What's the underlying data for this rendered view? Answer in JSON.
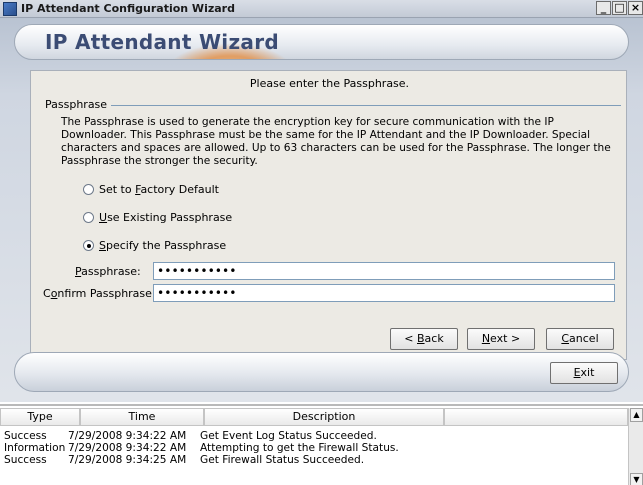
{
  "window": {
    "title": "IP Attendant Configuration Wizard",
    "minimize_label": "_",
    "maximize_label": "□",
    "close_label": "×"
  },
  "banner": {
    "title": "IP Attendant Wizard"
  },
  "prompt": "Please enter the Passphrase.",
  "group": {
    "label": "Passphrase",
    "description": "The Passphrase is used to generate the encryption key for secure communication with the IP Downloader. This Passphrase must be the same for the IP Attendant and the IP Downloader.  Special characters and spaces are allowed.  Up to 63 characters can be used for the Passphrase.  The longer the Passphrase the stronger the security."
  },
  "options": [
    {
      "pre": "Set to ",
      "u": "F",
      "post": "actory Default",
      "checked": false
    },
    {
      "pre": "",
      "u": "U",
      "post": "se Existing Passphrase",
      "checked": false
    },
    {
      "pre": "",
      "u": "S",
      "post": "pecify the Passphrase",
      "checked": true
    }
  ],
  "fields": {
    "passphrase_label_u": "P",
    "passphrase_label_rest": "assphrase:",
    "passphrase_value": "•••••••••••",
    "confirm_label_pre": "C",
    "confirm_label_u": "o",
    "confirm_label_rest": "nfirm Passphrase:",
    "confirm_value": "•••••••••••"
  },
  "buttons": {
    "back_pre": "< ",
    "back_u": "B",
    "back_rest": "ack",
    "next_u": "N",
    "next_rest": "ext >",
    "cancel_u": "C",
    "cancel_rest": "ancel",
    "exit_u": "E",
    "exit_rest": "xit"
  },
  "log": {
    "columns": [
      "Type",
      "Time",
      "Description",
      ""
    ],
    "rows": [
      {
        "type": "Success",
        "time": "7/29/2008 9:34:22 AM",
        "description": "Get Event Log Status Succeeded."
      },
      {
        "type": "Information",
        "time": "7/29/2008 9:34:22 AM",
        "description": "Attempting to get the Firewall Status."
      },
      {
        "type": "Success",
        "time": "7/29/2008 9:34:25 AM",
        "description": "Get Firewall Status Succeeded."
      }
    ]
  },
  "colors": {
    "banner_title": "#3b4c74",
    "panel_bg": "#eceae4",
    "group_line": "#7f9db9"
  }
}
